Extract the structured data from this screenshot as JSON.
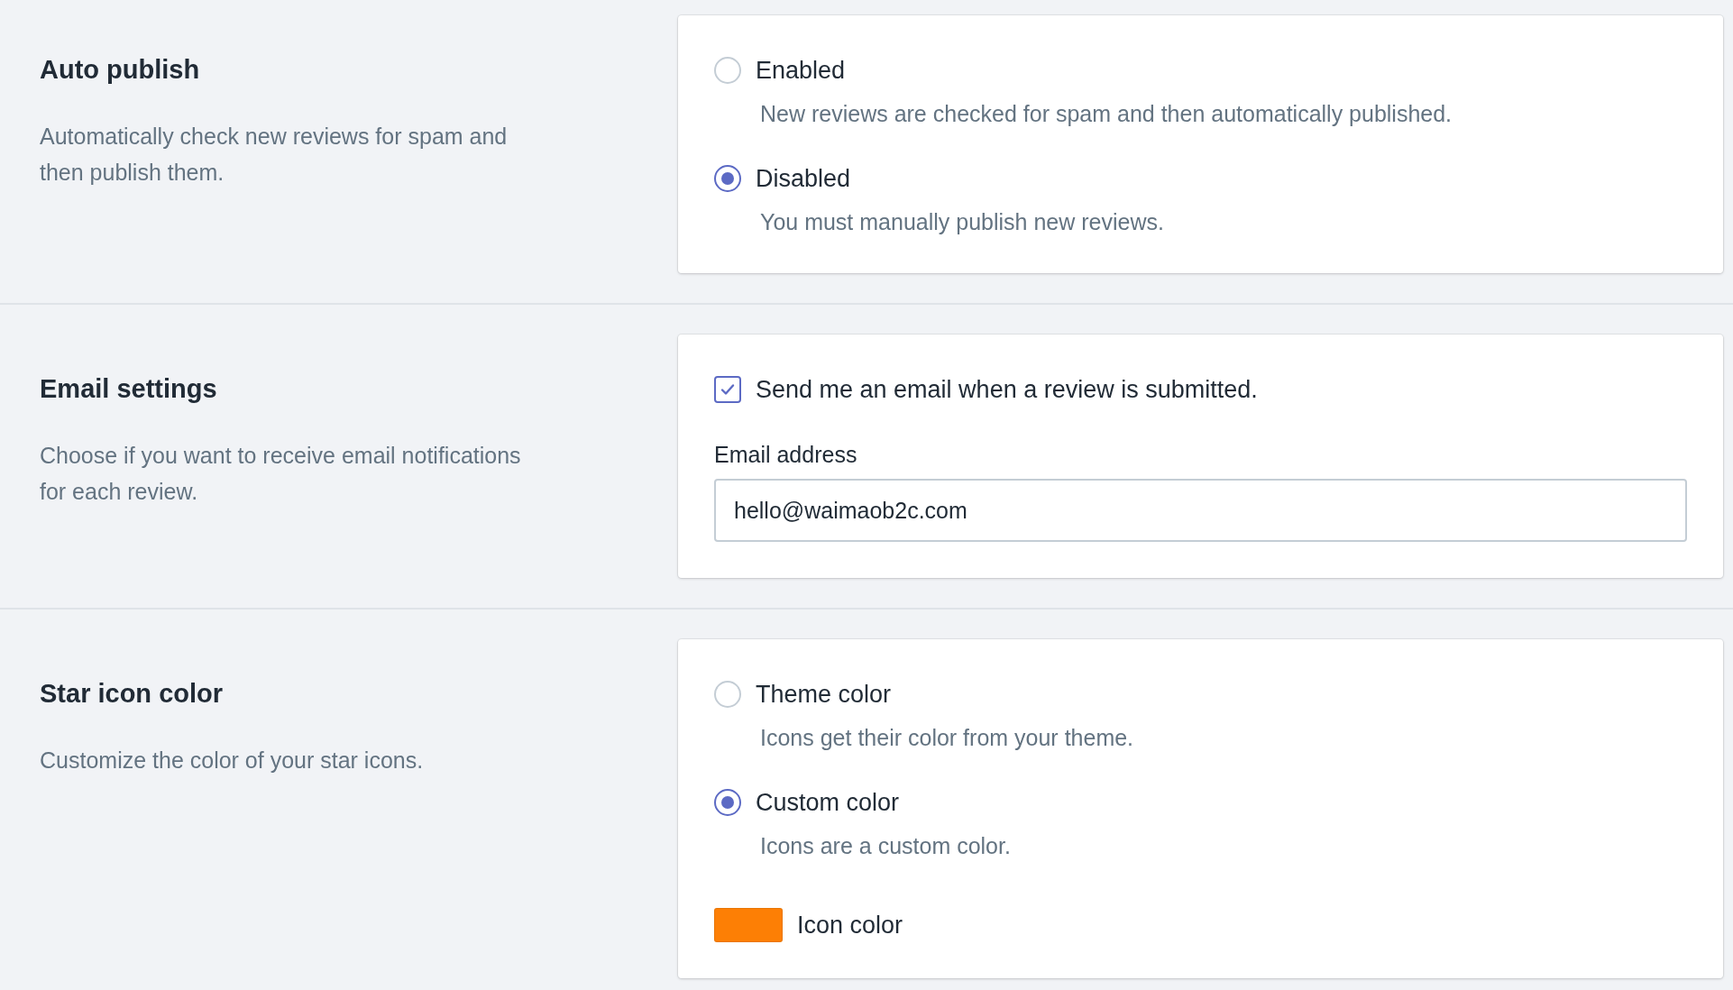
{
  "sections": [
    {
      "title": "Auto publish",
      "description": "Automatically check new reviews for spam and then publish them.",
      "controls": [
        {
          "kind": "radio",
          "label": "Enabled",
          "description": "New reviews are checked for spam and then automatically published.",
          "selected": false
        },
        {
          "kind": "radio",
          "label": "Disabled",
          "description": "You must manually publish new reviews.",
          "selected": true
        }
      ]
    },
    {
      "title": "Email settings",
      "description": "Choose if you want to receive email notifications for each review.",
      "controls": [
        {
          "kind": "checkbox",
          "label": "Send me an email when a review is submitted.",
          "checked": true
        },
        {
          "kind": "text-field",
          "label": "Email address",
          "value": "hello@waimaob2c.com"
        }
      ]
    },
    {
      "title": "Star icon color",
      "description": "Customize the color of your star icons.",
      "controls": [
        {
          "kind": "radio",
          "label": "Theme color",
          "description": "Icons get their color from your theme.",
          "selected": false
        },
        {
          "kind": "radio",
          "label": "Custom color",
          "description": "Icons are a custom color.",
          "selected": true
        },
        {
          "kind": "color-picker",
          "label": "Icon color",
          "color": "#fd7f05"
        }
      ]
    }
  ]
}
